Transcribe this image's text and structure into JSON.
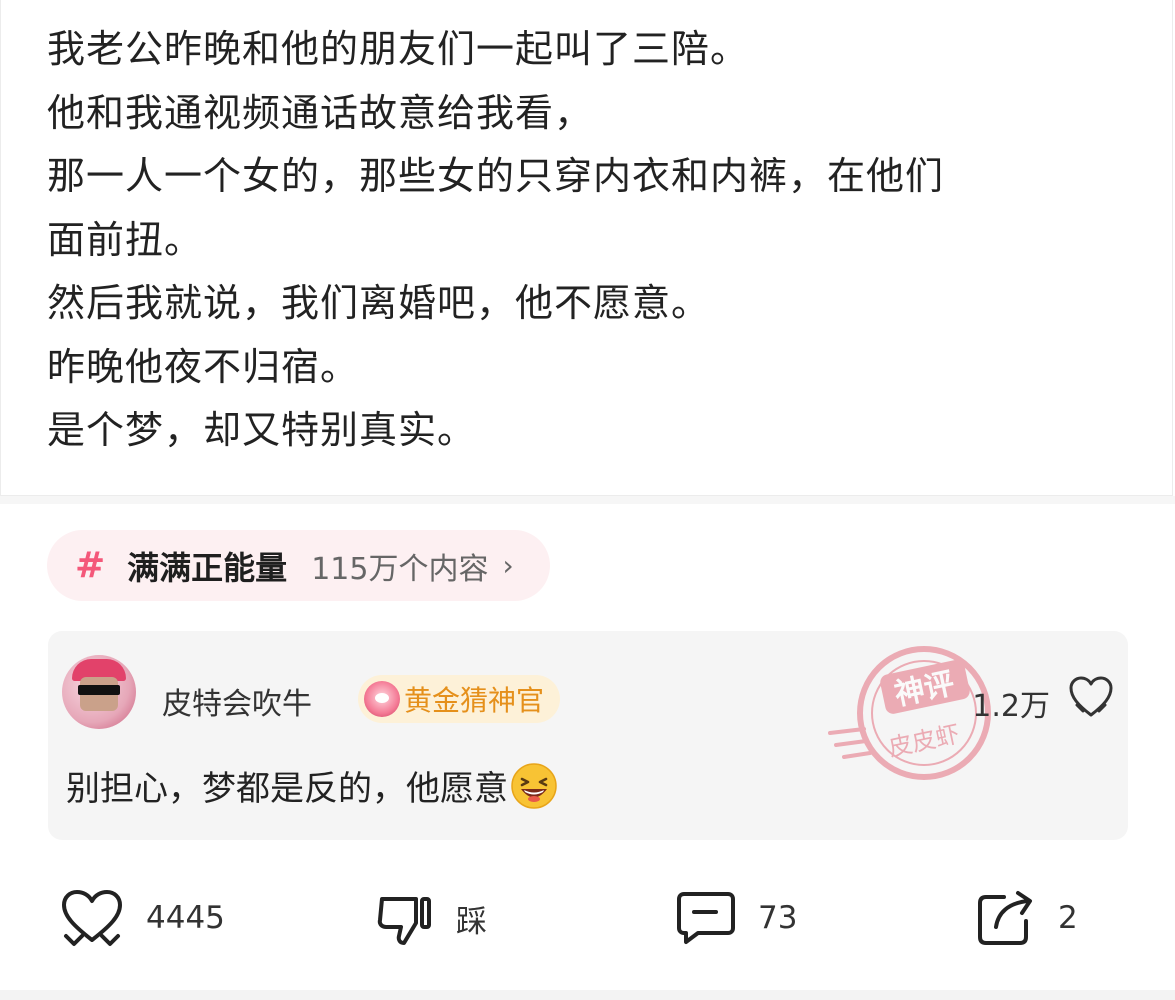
{
  "post": {
    "lines": [
      "我老公昨晚和他的朋友们一起叫了三陪。",
      "他和我通视频通话故意给我看，",
      "那一人一个女的，那些女的只穿内衣和内裤，在他们",
      "面前扭。",
      "然后我就说，我们离婚吧，他不愿意。",
      "昨晚他夜不归宿。",
      "是个梦，却又特别真实。"
    ]
  },
  "topic": {
    "icon": "hashtag-icon",
    "hash_symbol": "#",
    "name": "满满正能量",
    "count": "115万个内容",
    "chevron": "›"
  },
  "comment": {
    "username": "皮特会吹牛",
    "badge": {
      "label": "黄金猜神官",
      "icon": "gold-guess-badge-icon"
    },
    "stamp": {
      "icon": "shenping-stamp",
      "line1": "神评",
      "line2": "皮皮虾",
      "color": "#e4707f"
    },
    "likes": "1.2万",
    "text": "别担心，梦都是反的，他愿意",
    "emoji": "laughing-emoji"
  },
  "actions": {
    "like": {
      "icon": "heart-icon",
      "label": "4445"
    },
    "dislike": {
      "icon": "thumbs-down-icon",
      "label": "踩"
    },
    "comment": {
      "icon": "comment-icon",
      "label": "73"
    },
    "share": {
      "icon": "share-icon",
      "label": "2"
    }
  },
  "colors": {
    "accent_pink": "#f4587a",
    "topic_bg": "#fdf0f2",
    "badge_text": "#e5901b",
    "badge_bg": "#fdf1d8",
    "comment_bg": "#f5f5f5"
  }
}
